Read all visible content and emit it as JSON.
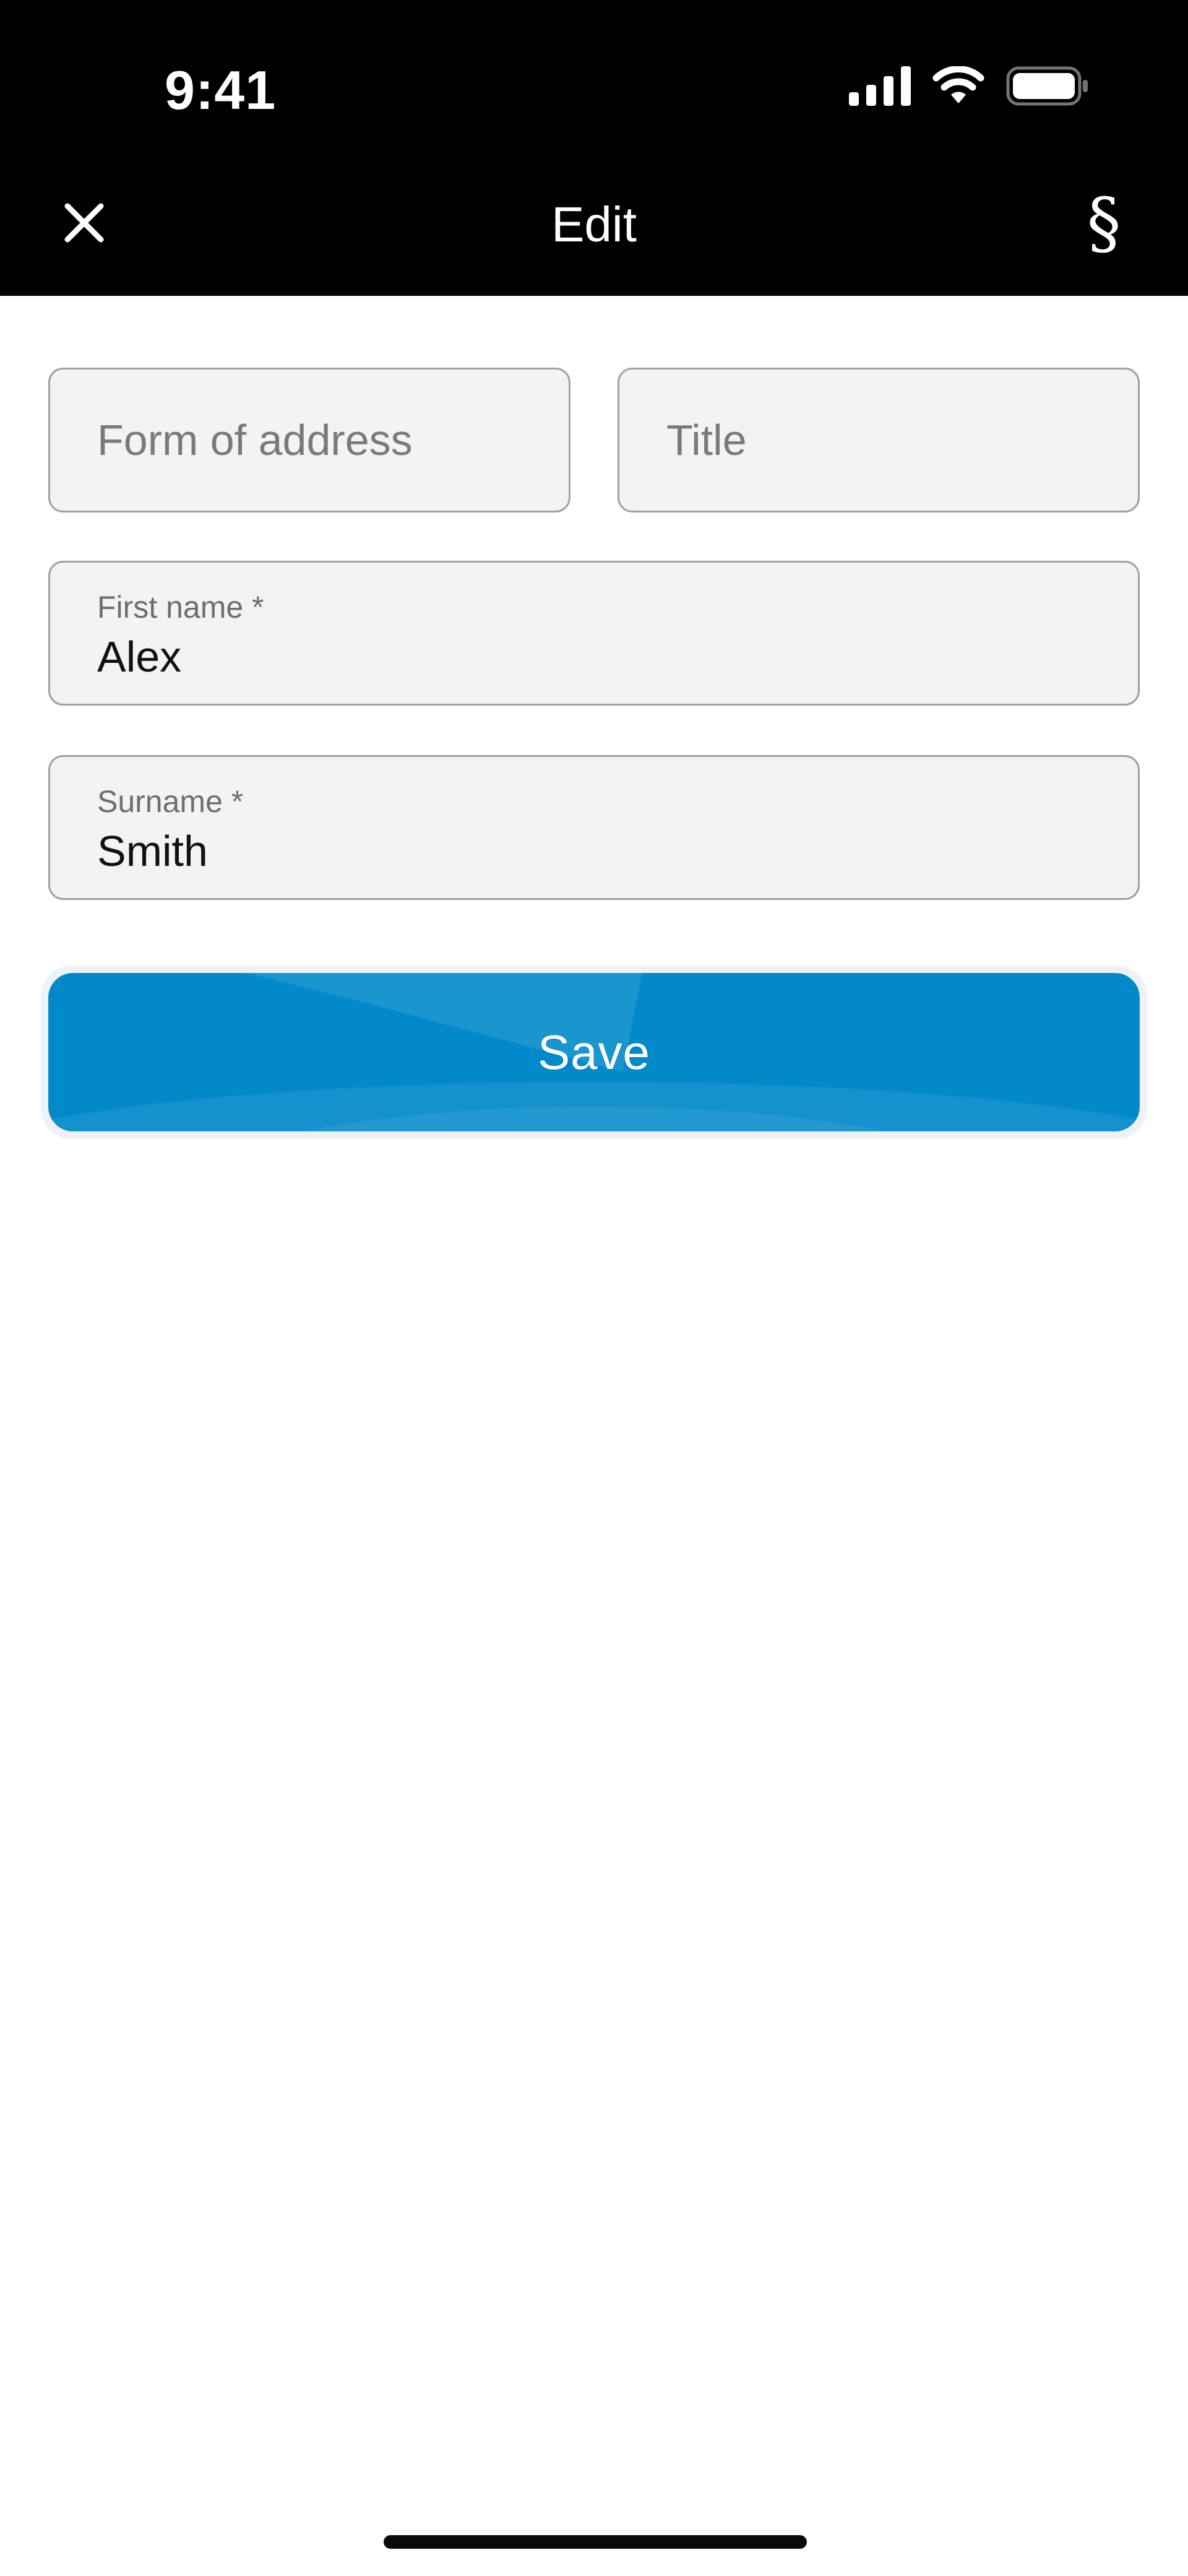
{
  "status_bar": {
    "time": "9:41",
    "icons": [
      "cellular-signal-icon",
      "wifi-icon",
      "battery-icon"
    ]
  },
  "nav": {
    "title": "Edit",
    "close_icon": "close-icon",
    "legal_icon": "section-sign-icon",
    "legal_glyph": "§"
  },
  "form": {
    "form_of_address": {
      "placeholder": "Form of address"
    },
    "title": {
      "placeholder": "Title"
    },
    "first_name": {
      "label": "First name *",
      "value": "Alex"
    },
    "surname": {
      "label": "Surname *",
      "value": "Smith"
    }
  },
  "actions": {
    "save_label": "Save"
  },
  "colors": {
    "header_bg": "#000000",
    "primary": "#0189c9",
    "field_bg": "#f3f3f3",
    "field_border": "#a0a0a0"
  }
}
